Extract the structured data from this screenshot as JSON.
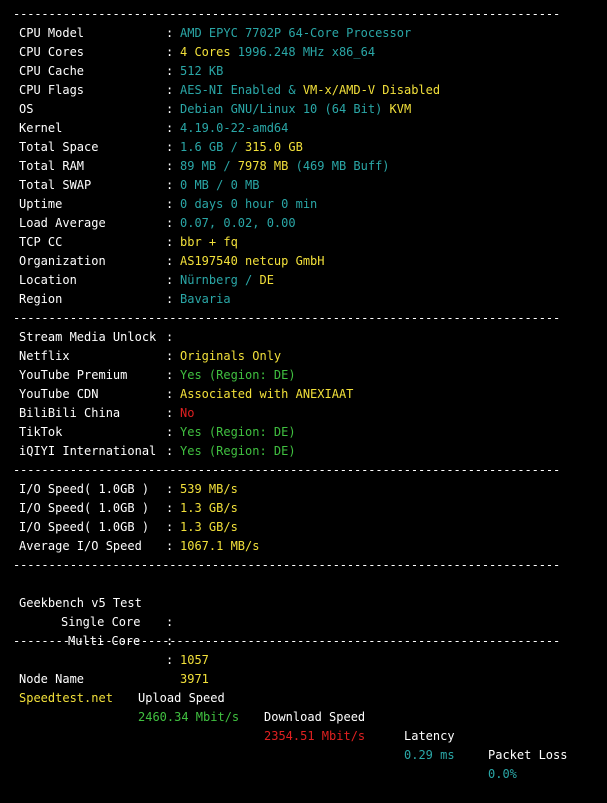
{
  "separator": "-----------------------------------------------------------------------------",
  "colon": ":",
  "system": [
    {
      "key": "CPU Model",
      "parts": [
        {
          "t": "AMD EPYC 7702P 64-Core Processor",
          "c": "cy"
        }
      ]
    },
    {
      "key": "CPU Cores",
      "parts": [
        {
          "t": "4 Cores",
          "c": "yl"
        },
        {
          "t": " 1996.248 MHz x86_64",
          "c": "cy"
        }
      ]
    },
    {
      "key": "CPU Cache",
      "parts": [
        {
          "t": "512 KB",
          "c": "cy"
        }
      ]
    },
    {
      "key": "CPU Flags",
      "parts": [
        {
          "t": "AES-NI Enabled & ",
          "c": "cy"
        },
        {
          "t": "VM-x/AMD-V Disabled",
          "c": "yl"
        }
      ]
    },
    {
      "key": "OS",
      "parts": [
        {
          "t": "Debian GNU/Linux 10 (64 Bit) ",
          "c": "cy"
        },
        {
          "t": "KVM",
          "c": "yl"
        }
      ]
    },
    {
      "key": "Kernel",
      "parts": [
        {
          "t": "4.19.0-22-amd64",
          "c": "cy"
        }
      ]
    },
    {
      "key": "Total Space",
      "parts": [
        {
          "t": "1.6 GB / ",
          "c": "cy"
        },
        {
          "t": "315.0 GB",
          "c": "yl"
        }
      ]
    },
    {
      "key": "Total RAM",
      "parts": [
        {
          "t": "89 MB / ",
          "c": "cy"
        },
        {
          "t": "7978 MB",
          "c": "yl"
        },
        {
          "t": " (469 MB Buff)",
          "c": "cy"
        }
      ]
    },
    {
      "key": "Total SWAP",
      "parts": [
        {
          "t": "0 MB / 0 MB",
          "c": "cy"
        }
      ]
    },
    {
      "key": "Uptime",
      "parts": [
        {
          "t": "0 days 0 hour 0 min",
          "c": "cy"
        }
      ]
    },
    {
      "key": "Load Average",
      "parts": [
        {
          "t": "0.07, 0.02, 0.00",
          "c": "cy"
        }
      ]
    },
    {
      "key": "TCP CC",
      "parts": [
        {
          "t": "bbr + fq",
          "c": "yl"
        }
      ]
    },
    {
      "key": "Organization",
      "parts": [
        {
          "t": "AS197540 netcup GmbH",
          "c": "yl"
        }
      ]
    },
    {
      "key": "Location",
      "parts": [
        {
          "t": "Nürnberg / ",
          "c": "cy"
        },
        {
          "t": "DE",
          "c": "yl"
        }
      ]
    },
    {
      "key": "Region",
      "parts": [
        {
          "t": "Bavaria",
          "c": "cy"
        }
      ]
    }
  ],
  "media": [
    {
      "key": "Stream Media Unlock",
      "parts": []
    },
    {
      "key": "Netflix",
      "parts": [
        {
          "t": "Originals Only",
          "c": "yl"
        }
      ]
    },
    {
      "key": "YouTube Premium",
      "parts": [
        {
          "t": "Yes (Region: DE)",
          "c": "gr"
        }
      ]
    },
    {
      "key": "YouTube CDN",
      "parts": [
        {
          "t": "Associated with ANEXIAAT",
          "c": "yl"
        }
      ]
    },
    {
      "key": "BiliBili China",
      "parts": [
        {
          "t": "No",
          "c": "rd"
        }
      ]
    },
    {
      "key": "TikTok",
      "parts": [
        {
          "t": "Yes (Region: DE)",
          "c": "gr"
        }
      ]
    },
    {
      "key": "iQIYI International",
      "parts": [
        {
          "t": "Yes (Region: DE)",
          "c": "gr"
        }
      ]
    }
  ],
  "io": [
    {
      "key": "I/O Speed( 1.0GB )",
      "parts": [
        {
          "t": "539 MB/s",
          "c": "yl"
        }
      ]
    },
    {
      "key": "I/O Speed( 1.0GB )",
      "parts": [
        {
          "t": "1.3 GB/s",
          "c": "yl"
        }
      ]
    },
    {
      "key": "I/O Speed( 1.0GB )",
      "parts": [
        {
          "t": "1.3 GB/s",
          "c": "yl"
        }
      ]
    },
    {
      "key": "Average I/O Speed",
      "parts": [
        {
          "t": "1067.1 MB/s",
          "c": "yl"
        }
      ]
    }
  ],
  "geekbench": {
    "title": "Geekbench v5 Test",
    "single_label": "Single Core",
    "single_value": "1057",
    "multi_label": "Multi Core",
    "multi_value": "3971"
  },
  "speedtest": {
    "headers": [
      "Node Name",
      "Upload Speed",
      "Download Speed",
      "Latency",
      "Packet Loss"
    ],
    "rows": [
      {
        "node": "Speedtest.net",
        "upload": "2460.34 Mbit/s",
        "download": "2354.51 Mbit/s",
        "latency": "0.29 ms",
        "loss": "0.0%"
      }
    ]
  }
}
